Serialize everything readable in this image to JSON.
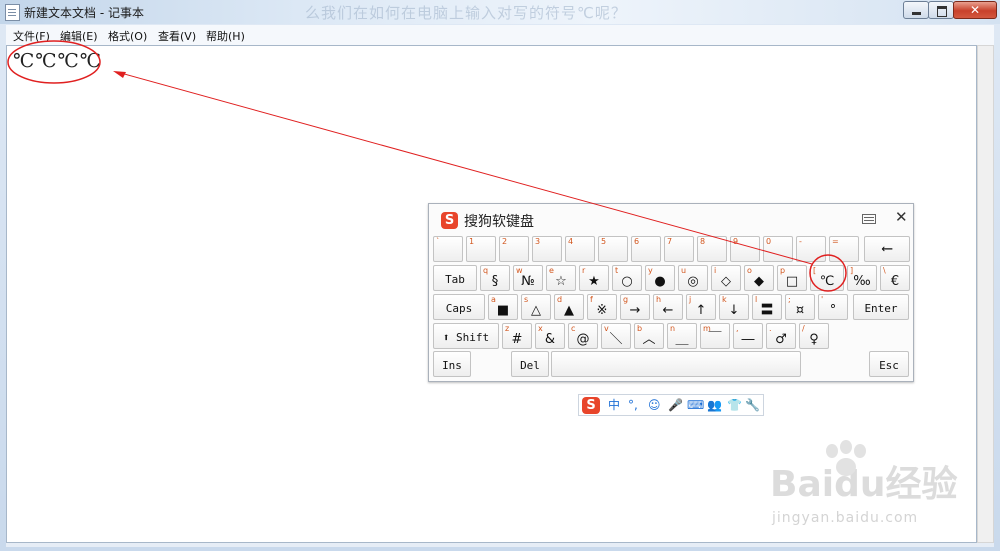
{
  "window": {
    "title": "新建文本文档 - 记事本",
    "background_title_ghost": "么我们在如何在电脑上输入对写的符号℃呢？"
  },
  "menu": [
    {
      "label": "文件(F)"
    },
    {
      "label": "编辑(E)"
    },
    {
      "label": "格式(O)"
    },
    {
      "label": "查看(V)"
    },
    {
      "label": "帮助(H)"
    }
  ],
  "editor": {
    "content": "℃℃℃℃"
  },
  "soft_keyboard": {
    "title": "搜狗软键盘",
    "logo": "S",
    "rows": [
      [
        {
          "sub": "`",
          "main": ""
        },
        {
          "sub": "1",
          "main": ""
        },
        {
          "sub": "2",
          "main": ""
        },
        {
          "sub": "3",
          "main": ""
        },
        {
          "sub": "4",
          "main": ""
        },
        {
          "sub": "5",
          "main": ""
        },
        {
          "sub": "6",
          "main": ""
        },
        {
          "sub": "7",
          "main": ""
        },
        {
          "sub": "8",
          "main": ""
        },
        {
          "sub": "9",
          "main": ""
        },
        {
          "sub": "0",
          "main": ""
        },
        {
          "sub": "-",
          "main": ""
        },
        {
          "sub": "=",
          "main": ""
        },
        {
          "sub": "",
          "main": "⟵",
          "wide": true
        }
      ],
      [
        {
          "sub": "",
          "main": "Tab",
          "wide": true
        },
        {
          "sub": "q",
          "main": "§"
        },
        {
          "sub": "w",
          "main": "№"
        },
        {
          "sub": "e",
          "main": "☆"
        },
        {
          "sub": "r",
          "main": "★"
        },
        {
          "sub": "t",
          "main": "○"
        },
        {
          "sub": "y",
          "main": "●"
        },
        {
          "sub": "u",
          "main": "◎"
        },
        {
          "sub": "i",
          "main": "◇"
        },
        {
          "sub": "o",
          "main": "◆"
        },
        {
          "sub": "p",
          "main": "□"
        },
        {
          "sub": "[",
          "main": "℃"
        },
        {
          "sub": "]",
          "main": "‰"
        },
        {
          "sub": "\\",
          "main": "€"
        }
      ],
      [
        {
          "sub": "",
          "main": "Caps",
          "wide": true
        },
        {
          "sub": "a",
          "main": "■"
        },
        {
          "sub": "s",
          "main": "△"
        },
        {
          "sub": "d",
          "main": "▲"
        },
        {
          "sub": "f",
          "main": "※"
        },
        {
          "sub": "g",
          "main": "→"
        },
        {
          "sub": "h",
          "main": "←"
        },
        {
          "sub": "j",
          "main": "↑"
        },
        {
          "sub": "k",
          "main": "↓"
        },
        {
          "sub": "l",
          "main": "〓"
        },
        {
          "sub": ";",
          "main": "¤"
        },
        {
          "sub": "'",
          "main": "°"
        },
        {
          "sub": "",
          "main": "Enter",
          "wide": true
        }
      ],
      [
        {
          "sub": "",
          "main": "⬆ Shift",
          "wide": true
        },
        {
          "sub": "z",
          "main": "#"
        },
        {
          "sub": "x",
          "main": "&"
        },
        {
          "sub": "c",
          "main": "@"
        },
        {
          "sub": "v",
          "main": "＼"
        },
        {
          "sub": "b",
          "main": "︿"
        },
        {
          "sub": "n",
          "main": "＿"
        },
        {
          "sub": "m",
          "main": "￣"
        },
        {
          "sub": ",",
          "main": "―"
        },
        {
          "sub": ".",
          "main": "♂"
        },
        {
          "sub": "/",
          "main": "♀"
        }
      ],
      [
        {
          "sub": "",
          "main": "Ins",
          "wide": true
        },
        {
          "sub": "",
          "main": "Del",
          "wide": true
        },
        {
          "sub": "",
          "main": "",
          "wide": true
        },
        {
          "sub": "",
          "main": "Esc",
          "wide": true
        }
      ]
    ]
  },
  "ime_toolbar": {
    "logo": "S",
    "items": [
      {
        "label": "中",
        "icon": "chinese-mode"
      },
      {
        "label": "°,",
        "icon": "punctuation"
      },
      {
        "label": "☺",
        "icon": "emoji"
      },
      {
        "label": "🎤",
        "icon": "microphone"
      },
      {
        "label": "⌨",
        "icon": "keyboard"
      },
      {
        "label": "👥",
        "icon": "user"
      },
      {
        "label": "👕",
        "icon": "skin"
      },
      {
        "label": "🔧",
        "icon": "wrench"
      }
    ]
  },
  "watermark": {
    "brand": "Baidu经验",
    "url": "jingyan.baidu.com"
  },
  "annotation_color": "#e02020"
}
